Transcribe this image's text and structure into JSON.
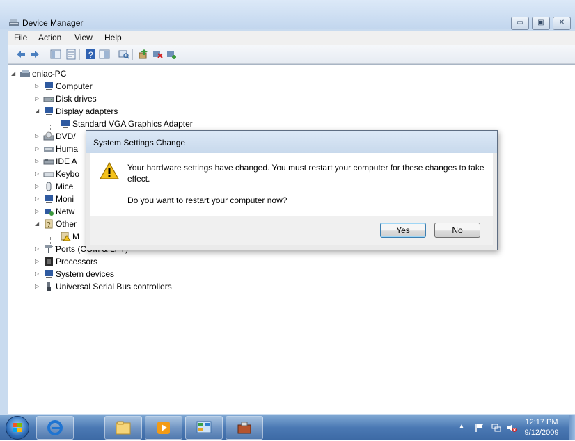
{
  "window": {
    "title": "Device Manager",
    "menu": [
      "File",
      "Action",
      "View",
      "Help"
    ]
  },
  "tree": {
    "root": "eniac-PC",
    "items": [
      {
        "label": "Computer"
      },
      {
        "label": "Disk drives"
      },
      {
        "label": "Display adapters"
      },
      {
        "label": "Standard VGA Graphics Adapter"
      },
      {
        "label": "DVD/"
      },
      {
        "label": "Huma"
      },
      {
        "label": "IDE A"
      },
      {
        "label": "Keybo"
      },
      {
        "label": "Mice"
      },
      {
        "label": "Moni"
      },
      {
        "label": "Netw"
      },
      {
        "label": "Other"
      },
      {
        "label": "M"
      },
      {
        "label": "Ports (COM & LPT)"
      },
      {
        "label": "Processors"
      },
      {
        "label": "System devices"
      },
      {
        "label": "Universal Serial Bus controllers"
      }
    ]
  },
  "dialog": {
    "title": "System Settings Change",
    "message": "Your hardware settings have changed. You must restart your computer for these changes to take effect.",
    "question": "Do you want to restart your computer now?",
    "yes_label": "Yes",
    "no_label": "No"
  },
  "taskbar": {
    "clock_time": "12:17 PM",
    "clock_date": "9/12/2009"
  }
}
